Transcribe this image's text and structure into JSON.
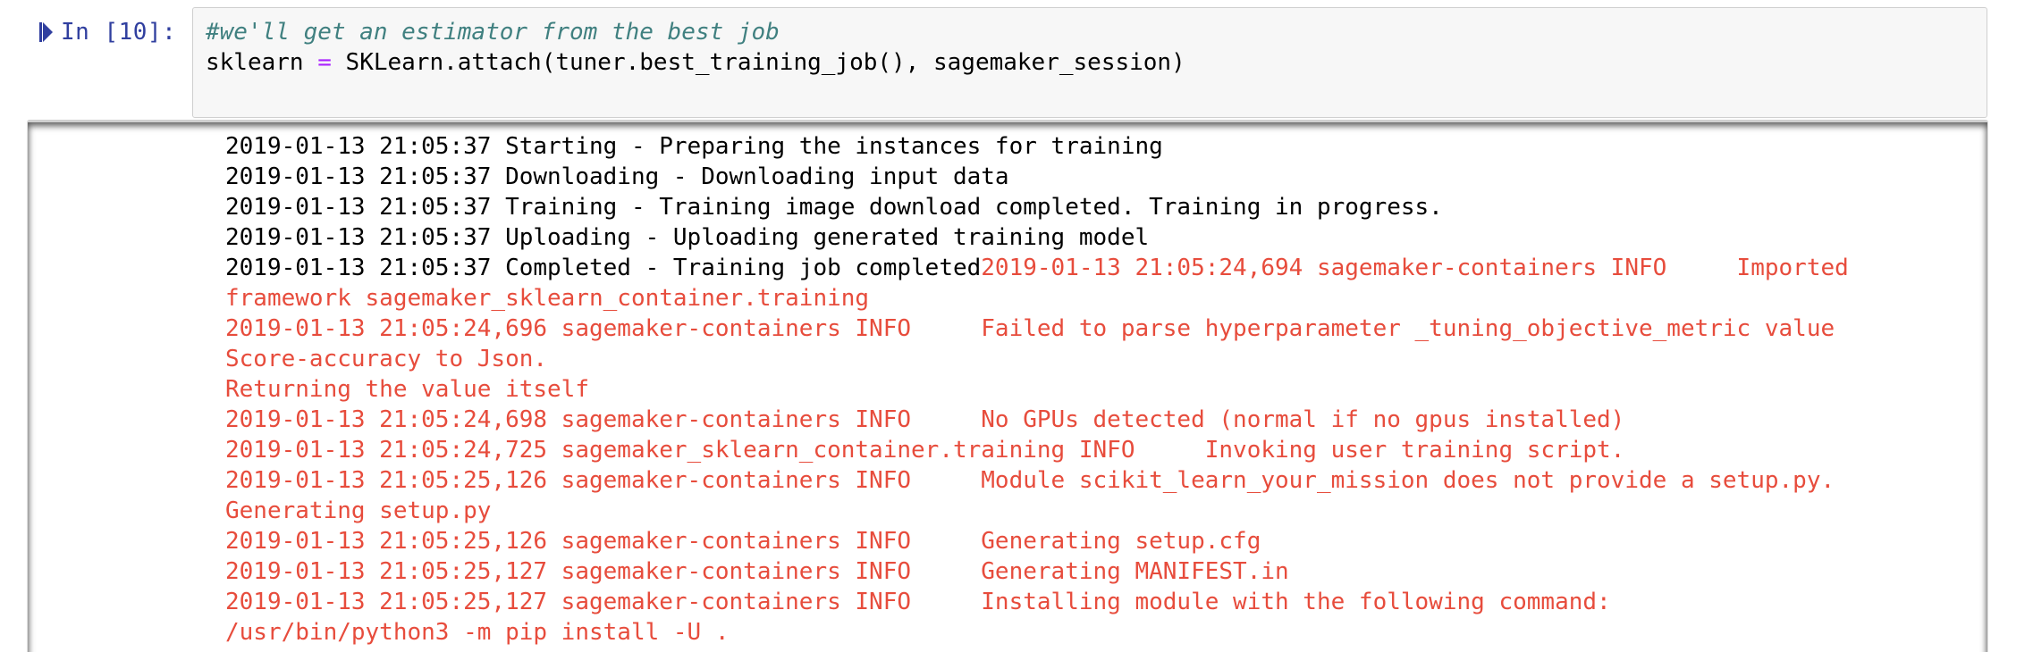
{
  "cell": {
    "prompt": "In [10]:",
    "code": [
      "#we'll get an estimator from the best job",
      "sklearn = SKLearn.attach(tuner.best_training_job(), sagemaker_session)"
    ],
    "code_parts": {
      "lhs": "sklearn ",
      "op": "=",
      "rhs": " SKLearn.attach(tuner.best_training_job(), sagemaker_session)"
    }
  },
  "output": {
    "stdout_lines": [
      "2019-01-13 21:05:37 Starting - Preparing the instances for training",
      "2019-01-13 21:05:37 Downloading - Downloading input data",
      "2019-01-13 21:05:37 Training - Training image download completed. Training in progress.",
      "2019-01-13 21:05:37 Uploading - Uploading generated training model",
      "2019-01-13 21:05:37 Completed - Training job completed"
    ],
    "mixed_tail": "2019-01-13 21:05:24,694 sagemaker-containers INFO     Imported",
    "stderr_lines": [
      "framework sagemaker_sklearn_container.training",
      "2019-01-13 21:05:24,696 sagemaker-containers INFO     Failed to parse hyperparameter _tuning_objective_metric value",
      "Score-accuracy to Json.",
      "Returning the value itself",
      "2019-01-13 21:05:24,698 sagemaker-containers INFO     No GPUs detected (normal if no gpus installed)",
      "2019-01-13 21:05:24,725 sagemaker_sklearn_container.training INFO     Invoking user training script.",
      "2019-01-13 21:05:25,126 sagemaker-containers INFO     Module scikit_learn_your_mission does not provide a setup.py.",
      "Generating setup.py",
      "2019-01-13 21:05:25,126 sagemaker-containers INFO     Generating setup.cfg",
      "2019-01-13 21:05:25,127 sagemaker-containers INFO     Generating MANIFEST.in",
      "2019-01-13 21:05:25,127 sagemaker-containers INFO     Installing module with the following command:",
      "/usr/bin/python3 -m pip install -U ."
    ]
  },
  "colors": {
    "prompt": "#303f9f",
    "comment": "#408080",
    "operator": "#aa22ff",
    "stderr": "#e74c3c",
    "stdout": "#000000",
    "input_bg": "#f7f7f7"
  },
  "icons": {
    "run_indicator": "step-forward-icon"
  }
}
